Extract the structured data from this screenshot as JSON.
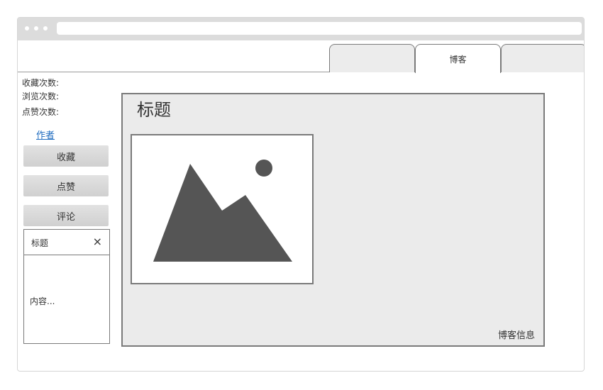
{
  "tabs": [
    {
      "label": ""
    },
    {
      "label": "博客"
    },
    {
      "label": ""
    }
  ],
  "stats": {
    "favorites_label": "收藏次数:",
    "views_label": "浏览次数:",
    "likes_label": "点赞次数:"
  },
  "sidebar": {
    "author_link": "作者",
    "buttons": {
      "favorite": "收藏",
      "like": "点赞",
      "comment": "评论"
    }
  },
  "popup": {
    "title": "标题",
    "close": "×",
    "content": "内容..."
  },
  "main": {
    "title": "标题",
    "image_icon": "image-placeholder-icon",
    "blog_info": "博客信息"
  },
  "colors": {
    "titlebar": "#dcdcdc",
    "panel_bg": "#ebebeb",
    "border": "#7a7a7a",
    "link": "#1e6bbf",
    "icon": "#555555"
  }
}
